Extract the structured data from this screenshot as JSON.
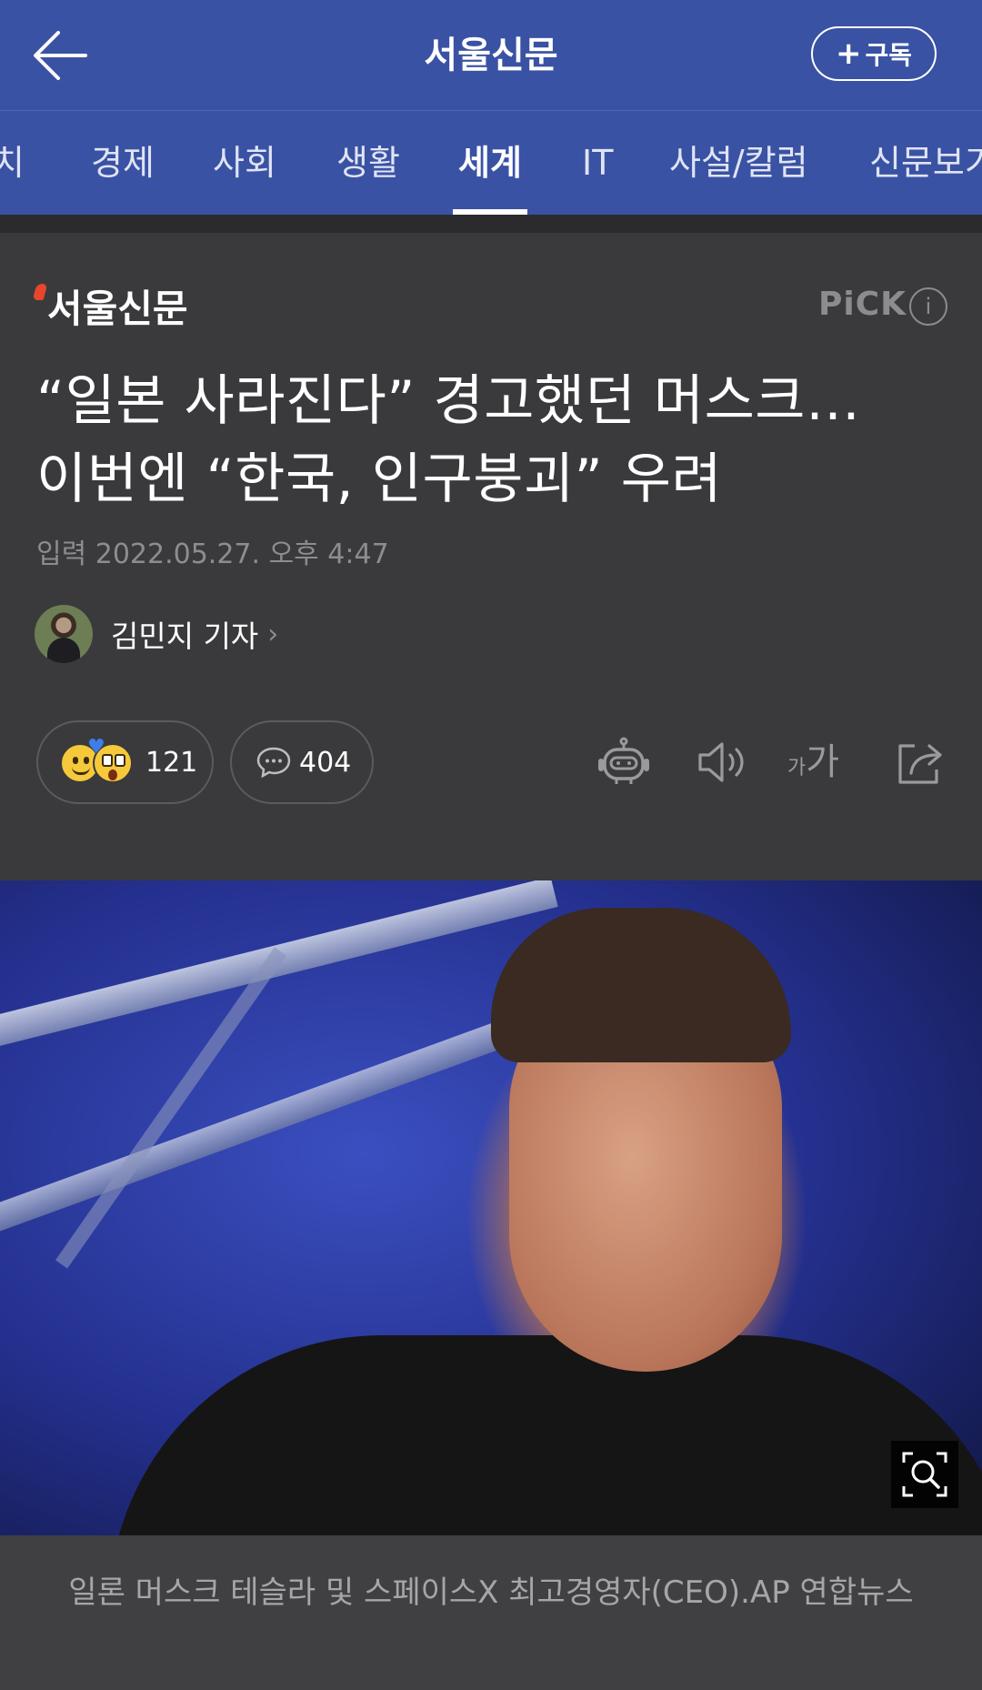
{
  "header": {
    "title": "서울신문",
    "subscribe_label": "구독",
    "subscribe_plus": "+"
  },
  "tabs": [
    {
      "label": "치",
      "active": false
    },
    {
      "label": "경제",
      "active": false
    },
    {
      "label": "사회",
      "active": false
    },
    {
      "label": "생활",
      "active": false
    },
    {
      "label": "세계",
      "active": true
    },
    {
      "label": "IT",
      "active": false
    },
    {
      "label": "사설/칼럼",
      "active": false
    },
    {
      "label": "신문보기",
      "active": false
    }
  ],
  "article": {
    "press_name": "서울신문",
    "pick_label": "PiCK",
    "pick_info": "i",
    "headline_line1": "“일본 사라진다” 경고했던 머스크…",
    "headline_line2": "이번엔 “한국, 인구붕괴” 우려",
    "dateline": "입력 2022.05.27. 오후 4:47",
    "author": "김민지 기자",
    "author_chevron": "›"
  },
  "actions": {
    "reaction_count": "121",
    "comment_count": "404",
    "font_small": "가",
    "font_large": "가"
  },
  "photo": {
    "caption": "일론 머스크 테슬라 및 스페이스X 최고경영자(CEO).AP 연합뉴스"
  },
  "colors": {
    "header_bg": "#3a52a3",
    "page_bg": "#3a3a3c",
    "logo_mark": "#e8452c"
  },
  "icons": [
    "back-arrow-icon",
    "robot-icon",
    "speaker-icon",
    "font-size-icon",
    "share-icon",
    "comment-bubble-icon",
    "zoom-icon"
  ]
}
